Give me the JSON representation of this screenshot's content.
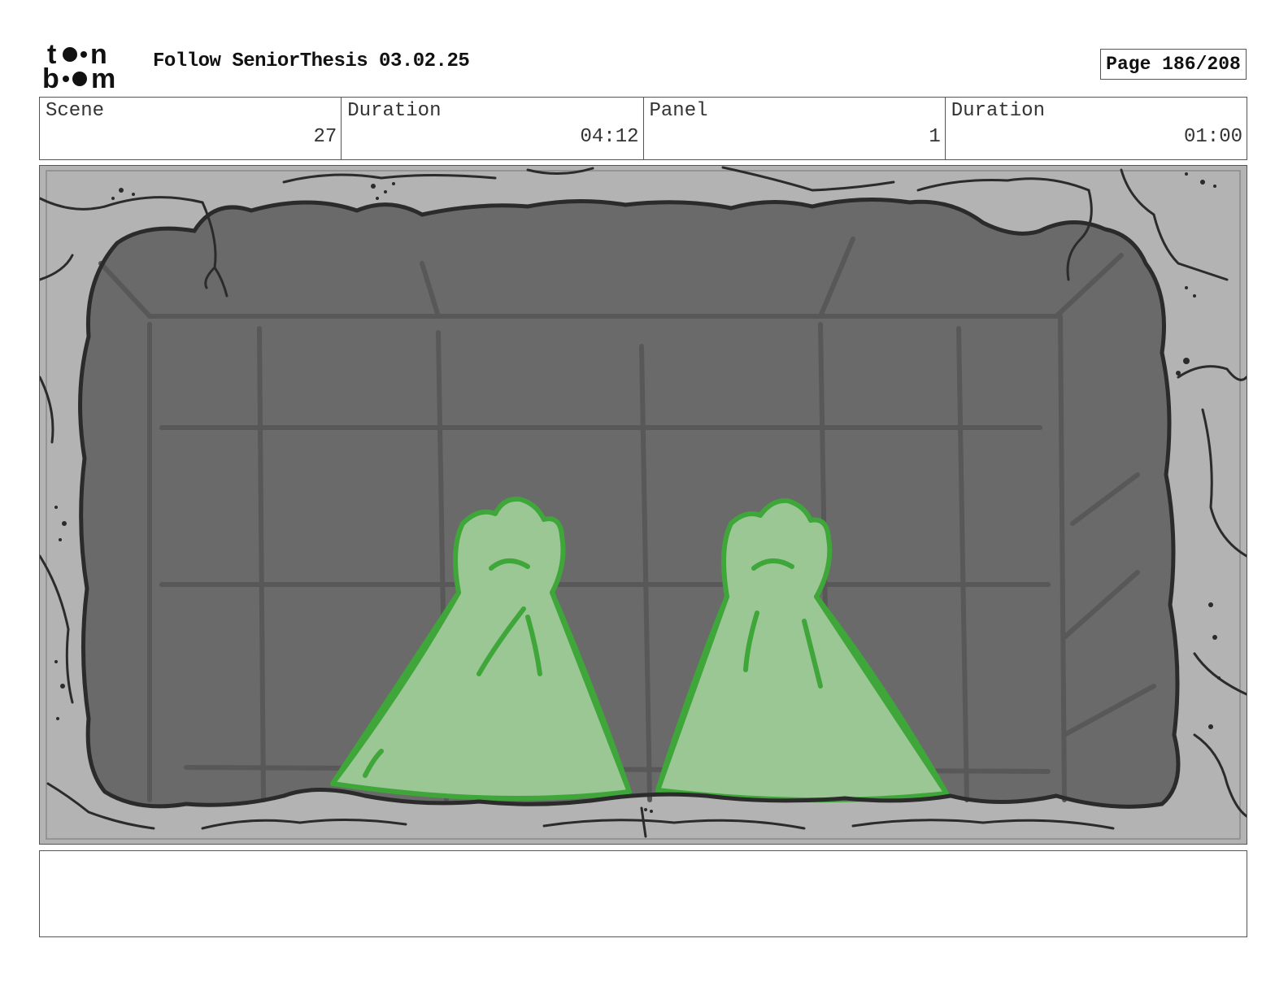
{
  "header": {
    "logo_name": "toon-boom-logo",
    "title": "Follow SeniorThesis 03.02.25",
    "page_label": "Page 186/208"
  },
  "info": [
    {
      "label": "Scene",
      "value": "27"
    },
    {
      "label": "Duration",
      "value": "04:12"
    },
    {
      "label": "Panel",
      "value": "1"
    },
    {
      "label": "Duration",
      "value": "01:00"
    }
  ],
  "panel": {
    "description_icon": "storyboard-drawing",
    "colors": {
      "frame": "#b3b3b3",
      "pit": "#6a6a6a",
      "grid": "#585858",
      "tentacle_fill": "#9ac794",
      "tentacle_outline": "#3fa63a",
      "ink": "#2b2b2b"
    }
  },
  "notes": {
    "text": ""
  }
}
